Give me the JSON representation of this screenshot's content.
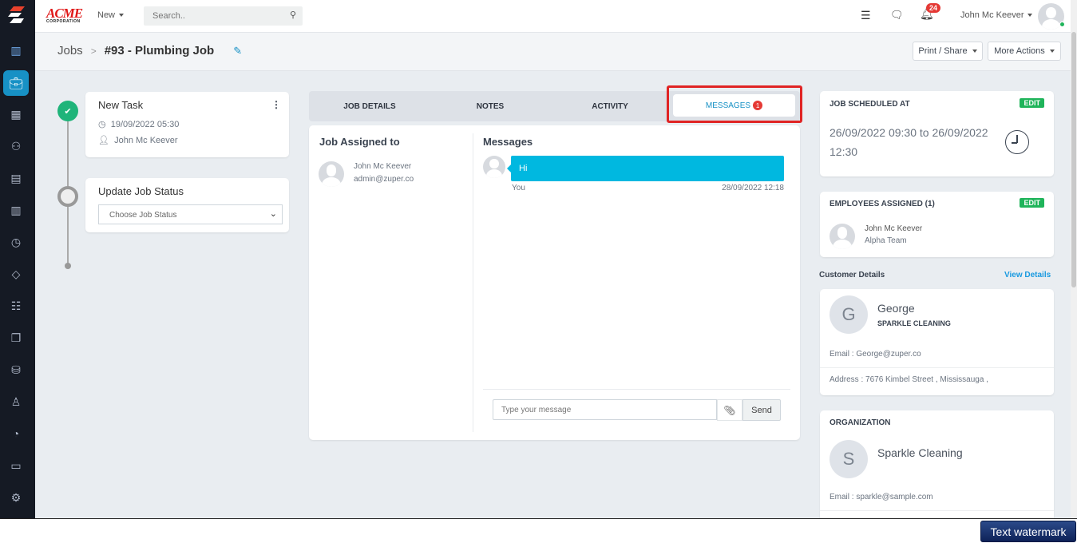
{
  "sidebar": {
    "items": [
      "dashboard",
      "jobs",
      "schedule",
      "customers",
      "invoices",
      "map",
      "timesheet",
      "tags",
      "checklist",
      "documents",
      "assets",
      "users",
      "reports",
      "display",
      "settings"
    ],
    "active": "jobs"
  },
  "header": {
    "brand": "ACME",
    "brand_sub": "CORPORATION",
    "new_label": "New",
    "search_placeholder": "Search..",
    "notification_count": "24",
    "user_name": "John Mc Keever"
  },
  "breadcrumb": {
    "root": "Jobs",
    "separator": ">",
    "current": "#93 - Plumbing Job"
  },
  "actions": {
    "print_share": "Print / Share",
    "more_actions": "More Actions"
  },
  "timeline": {
    "task": {
      "title": "New Task",
      "datetime": "19/09/2022 05:30",
      "assignee": "John Mc Keever"
    },
    "status": {
      "title": "Update Job Status",
      "select_value": "Choose Job Status"
    }
  },
  "tabs": [
    {
      "label": "JOB DETAILS"
    },
    {
      "label": "NOTES"
    },
    {
      "label": "ACTIVITY"
    },
    {
      "label": "MESSAGES",
      "badge": "1",
      "active": true
    }
  ],
  "assigned": {
    "title": "Job Assigned to",
    "name": "John Mc Keever",
    "email": "admin@zuper.co"
  },
  "messages": {
    "title": "Messages",
    "items": [
      {
        "text": "Hi",
        "sender": "You",
        "time": "28/09/2022 12:18"
      }
    ],
    "input_placeholder": "Type your message",
    "send_label": "Send"
  },
  "schedule": {
    "title": "JOB SCHEDULED AT",
    "edit": "EDIT",
    "text": "26/09/2022 09:30 to 26/09/2022 12:30"
  },
  "employees": {
    "title": "EMPLOYEES ASSIGNED (1)",
    "edit": "EDIT",
    "name": "John Mc Keever",
    "team": "Alpha Team"
  },
  "customer": {
    "section": "Customer Details",
    "view_link": "View Details",
    "initial": "G",
    "name": "George",
    "company": "SPARKLE CLEANING",
    "email": "Email : George@zuper.co",
    "address": "Address : 7676 Kimbel Street , Mississauga ,"
  },
  "organization": {
    "title": "ORGANIZATION",
    "initial": "S",
    "name": "Sparkle Cleaning",
    "email": "Email : sparkle@sample.com"
  },
  "watermark": "Text watermark",
  "colors": {
    "accent": "#1791c5",
    "message_bubble": "#00b8e0",
    "success": "#1fb45a",
    "highlight": "#e02424"
  }
}
